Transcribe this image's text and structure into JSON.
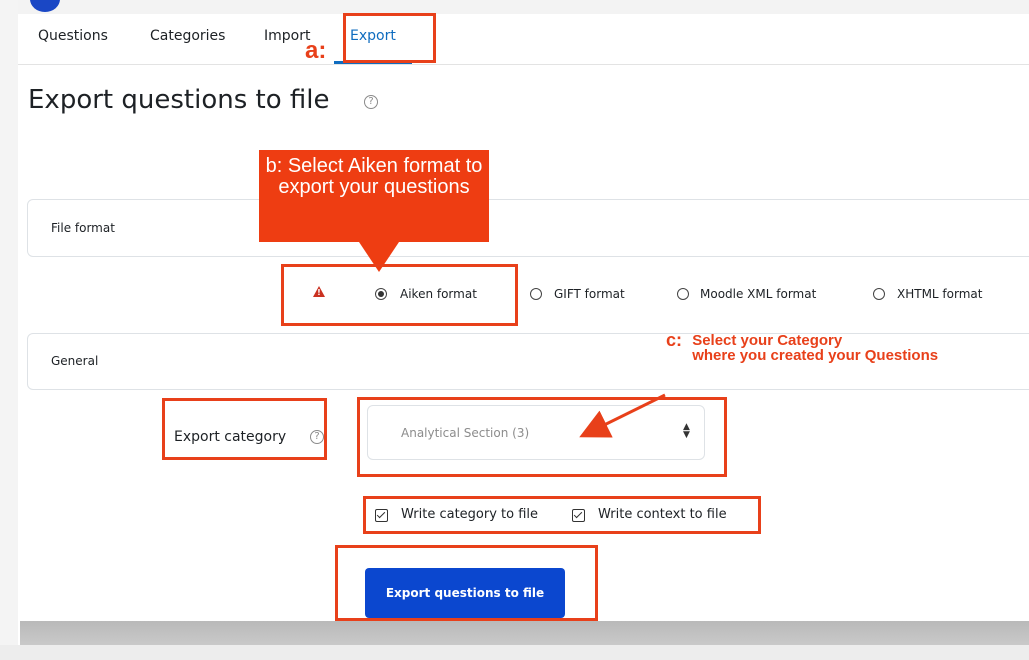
{
  "nav": {
    "tabs": [
      {
        "label": "Questions"
      },
      {
        "label": "Categories"
      },
      {
        "label": "Import"
      },
      {
        "label": "Export"
      }
    ],
    "active_tab": "Export"
  },
  "page": {
    "title": "Export questions to file",
    "help_glyph": "?"
  },
  "file_format": {
    "section_label": "File format",
    "options": [
      {
        "label": "Aiken format",
        "checked": true
      },
      {
        "label": "GIFT format",
        "checked": false
      },
      {
        "label": "Moodle XML format",
        "checked": false
      },
      {
        "label": "XHTML format",
        "checked": false
      }
    ],
    "warning_glyph": "!"
  },
  "general": {
    "section_label": "General",
    "export_category_label": "Export category",
    "category_value": "Analytical Section (3)",
    "write_category_label": "Write category to file",
    "write_category_checked": true,
    "write_context_label": "Write context to file",
    "write_context_checked": true
  },
  "actions": {
    "export_button_label": "Export questions to file"
  },
  "annotations": {
    "a_label": "a:",
    "b_text": "b: Select Aiken format to export your questions",
    "c_label": "c:",
    "c_text_line1": "Select your Category",
    "c_text_line2": "where you created your Questions",
    "color": "#e8401a"
  },
  "colors": {
    "link_blue": "#0f6cbf",
    "button_blue": "#0b47cf",
    "annotation_red": "#e8401a"
  }
}
